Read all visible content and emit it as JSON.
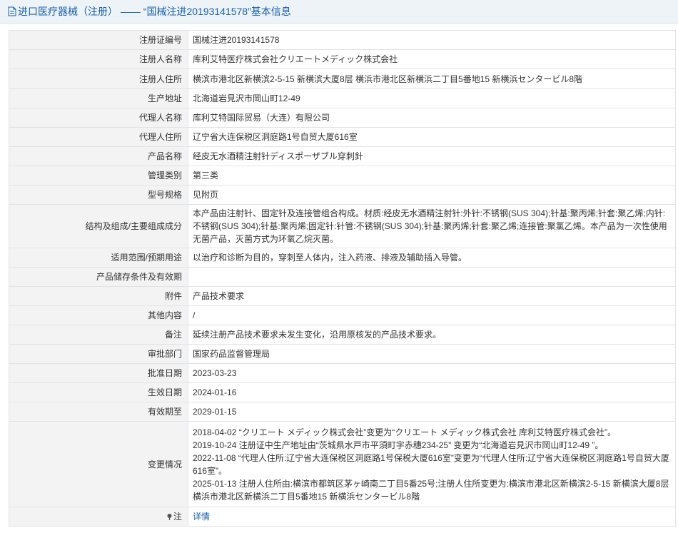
{
  "header": {
    "category": "进口医疗器械（注册）",
    "separator": " —— ",
    "title": "“国械注进20193141578”基本信息"
  },
  "rows": [
    {
      "label": "注册证编号",
      "value": "国械注进20193141578"
    },
    {
      "label": "注册人名称",
      "value": "库利艾特医疗株式会社クリエートメディック株式会社"
    },
    {
      "label": "注册人住所",
      "value": "横滨市港北区新横滨2-5-15 新横滨大厦8层 横浜市港北区新横浜二丁目5番地15 新横浜センタービル8階"
    },
    {
      "label": "生产地址",
      "value": "北海道岩見沢市岡山町12-49"
    },
    {
      "label": "代理人名称",
      "value": "库利艾特国际贸易（大连）有限公司"
    },
    {
      "label": "代理人住所",
      "value": "辽宁省大连保税区洞庭路1号自贸大厦616室"
    },
    {
      "label": "产品名称",
      "value": "经皮无水酒精注射针ディスポーザブル穿刺針"
    },
    {
      "label": "管理类别",
      "value": "第三类"
    },
    {
      "label": "型号规格",
      "value": "见附页"
    },
    {
      "label": "结构及组成/主要组成成分",
      "value": "本产品由注射针、固定针及连接管组合构成。材质:经皮无水酒精注射针:外针:不锈钢(SUS 304);针基:聚丙烯;针套:聚乙烯;内针:不锈钢(SUS 304);针基:聚丙烯;固定针:针管:不锈钢(SUS 304);针基:聚丙烯;针套:聚乙烯;连接管:聚氯乙烯。本产品为一次性使用无菌产品，灭菌方式为环氧乙烷灭菌。"
    },
    {
      "label": "适用范围/预期用途",
      "value": "以治疗和诊断为目的，穿刺至人体内，注入药液、排液及辅助插入导管。"
    },
    {
      "label": "产品储存条件及有效期",
      "value": ""
    },
    {
      "label": "附件",
      "value": "产品技术要求"
    },
    {
      "label": "其他内容",
      "value": "/"
    },
    {
      "label": "备注",
      "value": "延续注册产品技术要求未发生变化，沿用原核发的产品技术要求。"
    },
    {
      "label": "审批部门",
      "value": "国家药品监督管理局"
    },
    {
      "label": "批准日期",
      "value": "2023-03-23"
    },
    {
      "label": "生效日期",
      "value": "2024-01-16"
    },
    {
      "label": "有效期至",
      "value": "2029-01-15"
    }
  ],
  "changes": {
    "label": "变更情况",
    "lines": [
      "2018-04-02 “クリエート メディック株式会社”变更为“クリエート メディック株式会社 库利艾特医疗株式会社”。",
      "2019-10-24 注册证中生产地址由“茨城県水戸市平須町字赤穗234-25” 变更为“北海道岩見沢市岡山町12-49 ”。",
      "2022-11-08 “代理人住所:辽宁省大连保税区洞庭路1号保税大厦616室”变更为“代理人住所:辽宁省大连保税区洞庭路1号自贸大厦616室”。",
      "2025-01-13 注册人住所由:横滨市都筑区茅ヶ崎南二丁目5番25号;注册人住所变更为:横滨市港北区新横滨2-5-15 新横滨大厦8层　横浜市港北区新横浜二丁目5番地15 新横浜センタービル8階"
    ]
  },
  "note": {
    "label": "注",
    "link_text": "详情"
  },
  "colors": {
    "header_bg": "#eef3f8",
    "header_text": "#1a5fa8",
    "label_bg": "#f3f3f3",
    "border": "#dfe4ea",
    "link": "#1a5fa8"
  },
  "icons": {
    "header": "document-icon",
    "note": "pin-icon"
  }
}
